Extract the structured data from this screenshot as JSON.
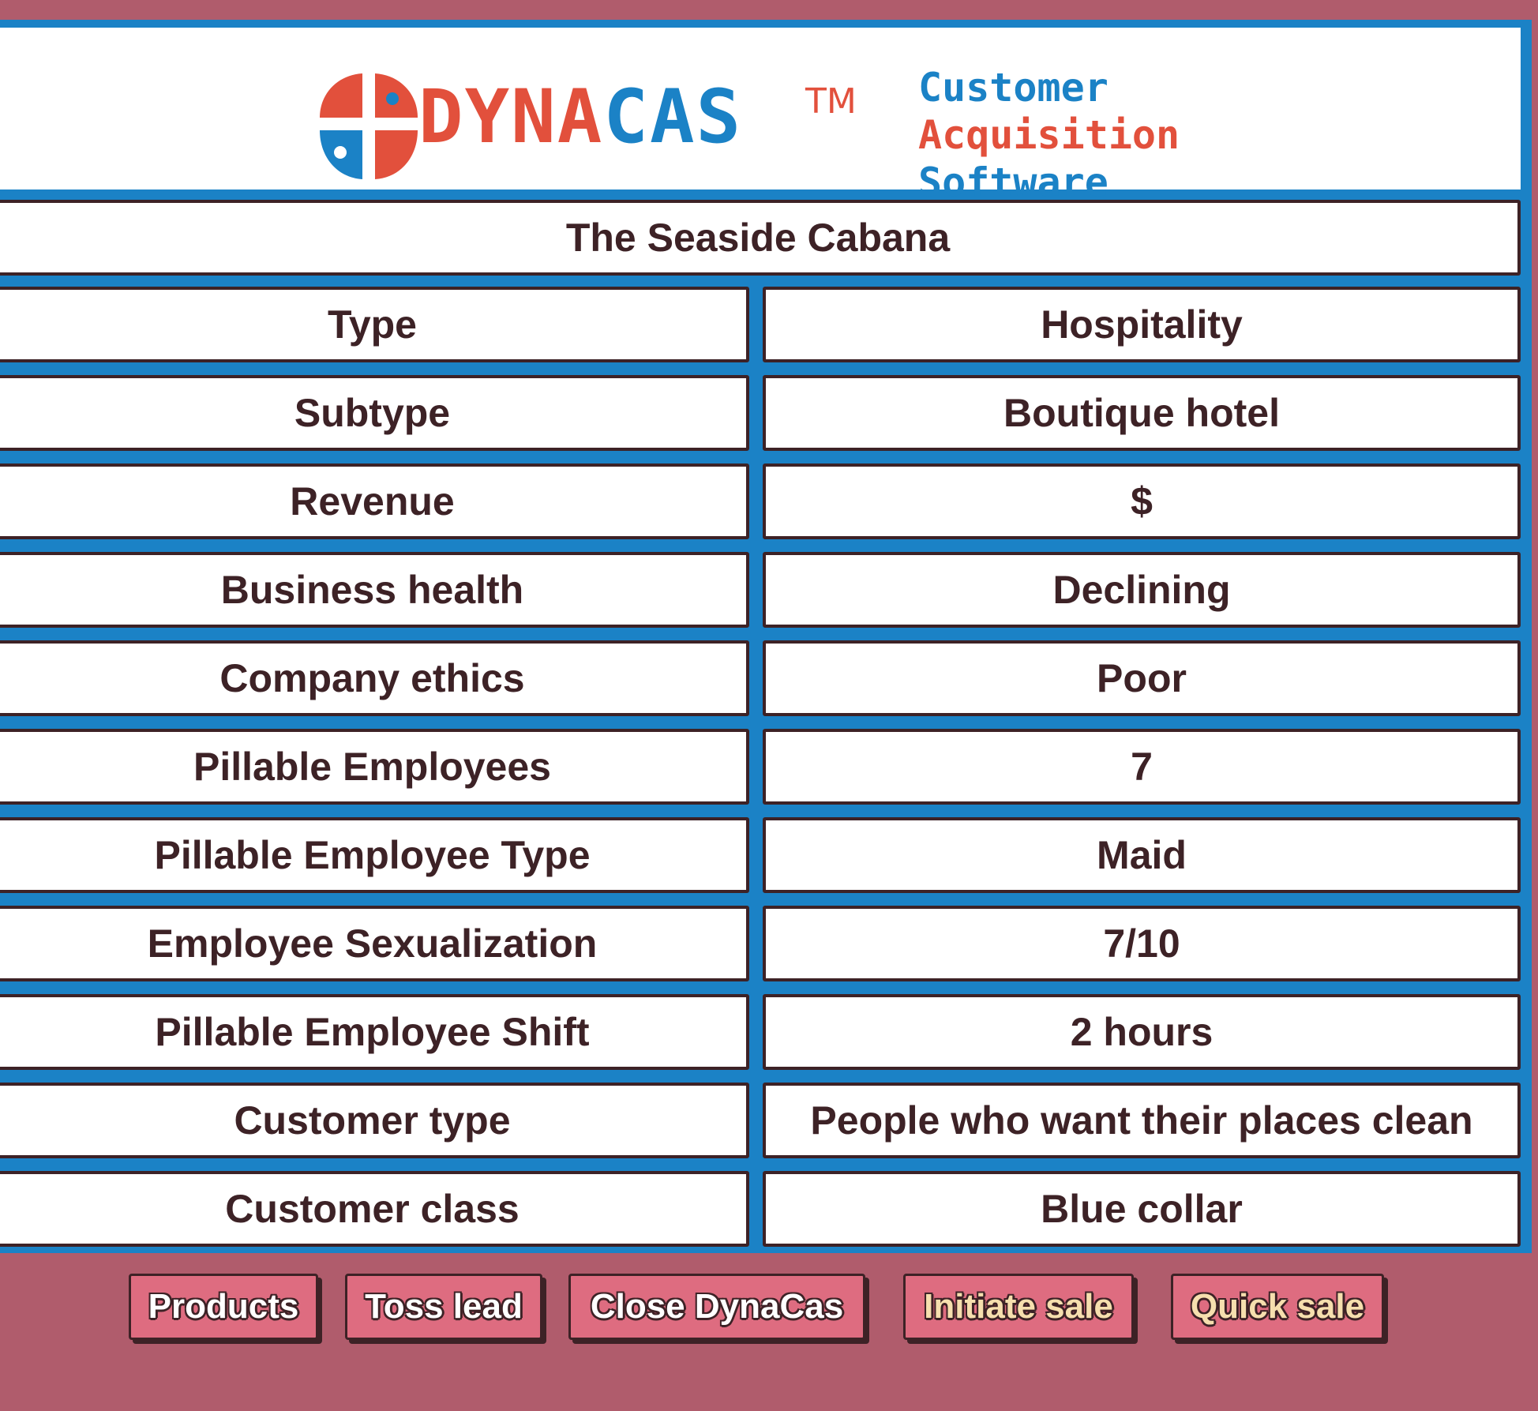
{
  "header": {
    "logo_text": "DYNACAS",
    "trademark": "TM",
    "tagline": [
      "Customer",
      "Acquisition",
      "Software"
    ]
  },
  "business": {
    "name": "The Seaside Cabana",
    "rows": [
      {
        "label": "Type",
        "value": "Hospitality"
      },
      {
        "label": "Subtype",
        "value": "Boutique hotel"
      },
      {
        "label": "Revenue",
        "value": "$"
      },
      {
        "label": "Business health",
        "value": "Declining"
      },
      {
        "label": "Company ethics",
        "value": "Poor"
      },
      {
        "label": "Pillable Employees",
        "value": "7"
      },
      {
        "label": "Pillable Employee Type",
        "value": "Maid"
      },
      {
        "label": "Employee Sexualization",
        "value": "7/10"
      },
      {
        "label": "Pillable Employee Shift",
        "value": "2 hours"
      },
      {
        "label": "Customer type",
        "value": "People who want their places clean"
      },
      {
        "label": "Customer class",
        "value": "Blue collar"
      }
    ]
  },
  "buttons": [
    {
      "label": "Products",
      "style": "light"
    },
    {
      "label": "Toss lead",
      "style": "light"
    },
    {
      "label": "Close DynaCas",
      "style": "light"
    },
    {
      "label": "Initiate sale",
      "style": "cream"
    },
    {
      "label": "Quick sale",
      "style": "cream"
    }
  ],
  "colors": {
    "background": "#b05c6c",
    "panel_blue": "#1b82c6",
    "logo_red": "#e2503c",
    "text_dark": "#3d2226",
    "button_pink": "#de6c80",
    "button_cream_text": "#f6dfae"
  }
}
